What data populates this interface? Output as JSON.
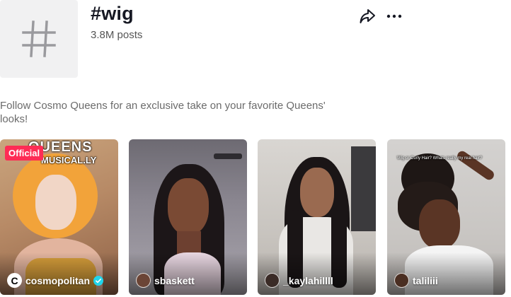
{
  "hashtag": {
    "title": "#wig",
    "posts": "3.8M posts",
    "description": "Follow Cosmo Queens for an exclusive take on your favorite Queens' looks!"
  },
  "icons": {
    "hashtag_icon": "hashtag-icon",
    "share_icon": "share-icon",
    "more_icon": "more-options-icon",
    "verified_icon": "verified-check-icon"
  },
  "colors": {
    "accent": "#fe2c55",
    "verified": "#20d5ec"
  },
  "videos": [
    {
      "username": "cosmopolitan",
      "verified": true,
      "badge": "Official",
      "overlay_line1": "QUEENS",
      "overlay_line2": "MUSICAL.LY",
      "avatar_letter": "C"
    },
    {
      "username": "sbaskett"
    },
    {
      "username": "_kaylahillll"
    },
    {
      "username": "taliliii",
      "caption": "Wig or Curly Hair? Whats really my real hair?"
    }
  ]
}
